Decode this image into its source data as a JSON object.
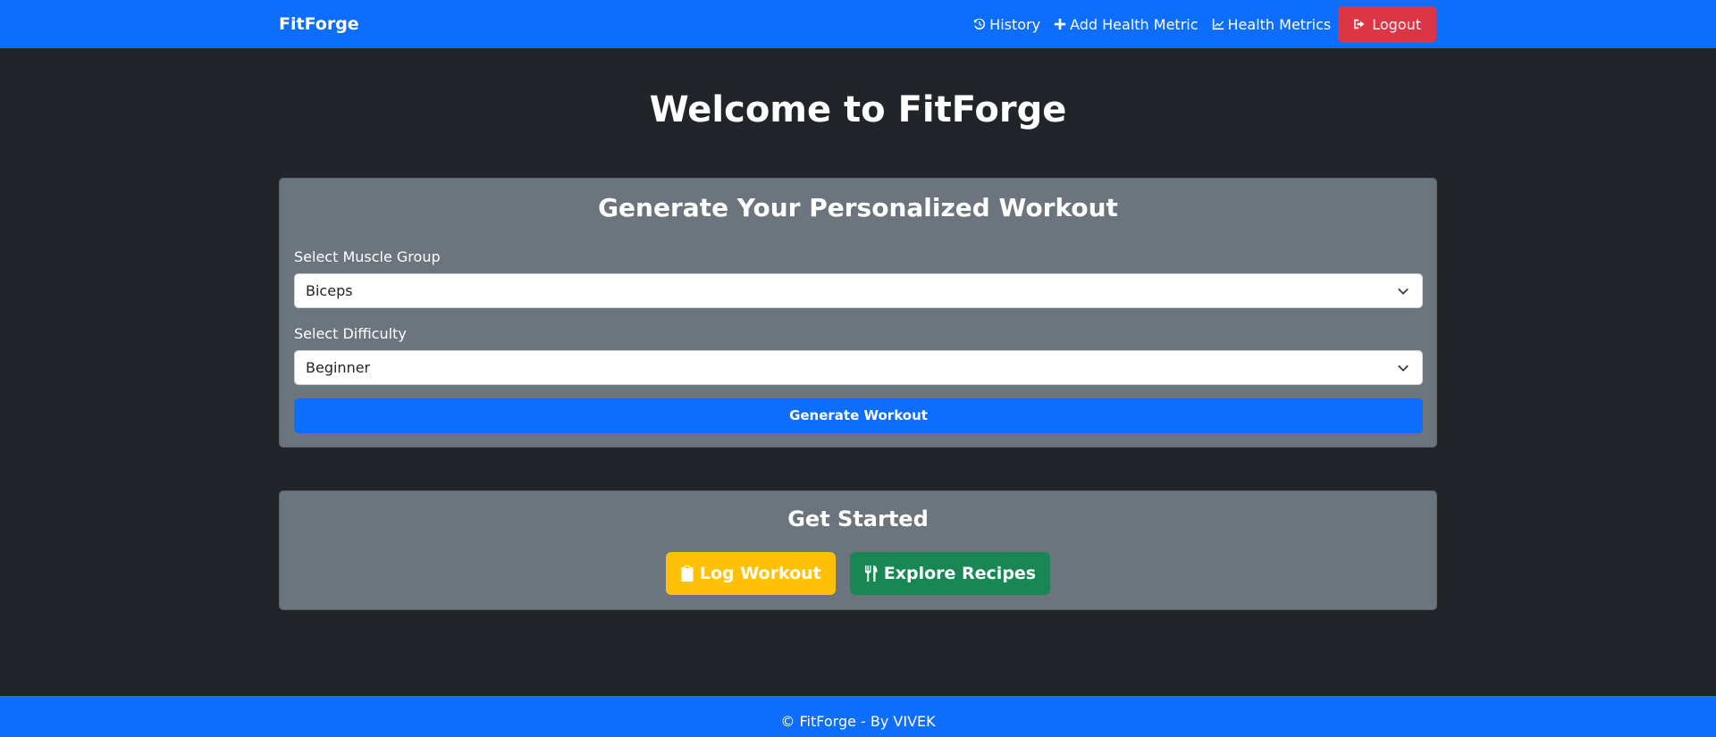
{
  "navbar": {
    "brand": "FitForge",
    "links": [
      {
        "label": "History",
        "icon": "history-icon"
      },
      {
        "label": "Add Health Metric",
        "icon": "plus-icon"
      },
      {
        "label": "Health Metrics",
        "icon": "line-chart-icon"
      }
    ],
    "logout": {
      "label": "Logout",
      "icon": "sign-out-icon"
    }
  },
  "page": {
    "title": "Welcome to FitForge"
  },
  "workout_card": {
    "heading": "Generate Your Personalized Workout",
    "muscle_group": {
      "label": "Select Muscle Group",
      "value": "Biceps"
    },
    "difficulty": {
      "label": "Select Difficulty",
      "value": "Beginner"
    },
    "generate_label": "Generate Workout"
  },
  "get_started_card": {
    "heading": "Get Started",
    "buttons": [
      {
        "label": "Log Workout",
        "icon": "clipboard-icon"
      },
      {
        "label": "Explore Recipes",
        "icon": "utensils-icon"
      }
    ]
  },
  "footer": {
    "text": "© FitForge - By VIVEK"
  },
  "colors": {
    "primary": "#0d6efd",
    "danger": "#dc3545",
    "warning": "#ffc107",
    "success": "#198754",
    "card_bg": "#6c757d",
    "page_bg": "#212529"
  }
}
